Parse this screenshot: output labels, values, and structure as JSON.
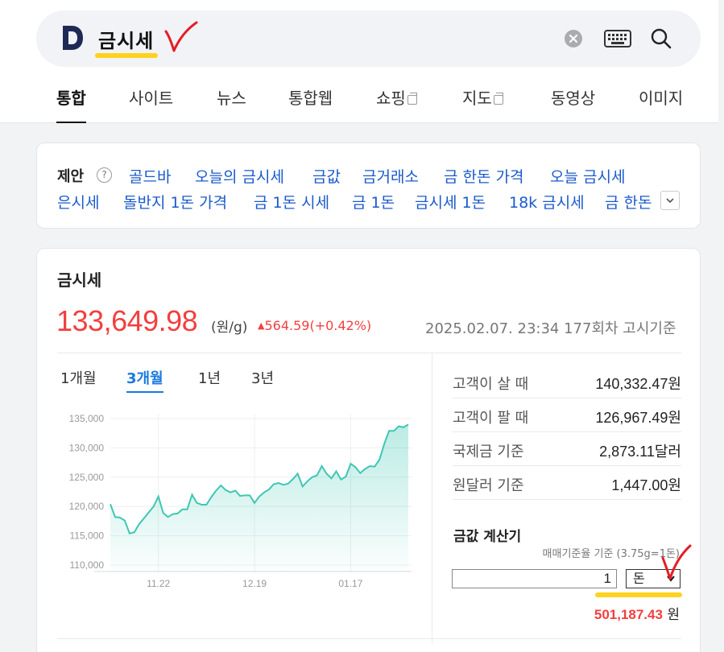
{
  "search": {
    "query": "금시세",
    "logo_letter": "D"
  },
  "tabs": [
    {
      "label": "통합",
      "active": true
    },
    {
      "label": "사이트"
    },
    {
      "label": "뉴스"
    },
    {
      "label": "통합웹"
    },
    {
      "label": "쇼핑",
      "external": true
    },
    {
      "label": "지도",
      "external": true
    },
    {
      "label": "동영상"
    },
    {
      "label": "이미지"
    }
  ],
  "suggestions": {
    "title": "제안",
    "help": "?",
    "row1": [
      "골드바",
      "오늘의 금시세",
      "금값",
      "금거래소",
      "금 한돈 가격",
      "오늘 금시세"
    ],
    "row2": [
      "은시세",
      "돌반지 1돈 가격",
      "금 1돈 시세",
      "금 1돈",
      "금시세 1돈",
      "18k 금시세",
      "금 한돈"
    ]
  },
  "gold": {
    "title": "금시세",
    "price": "133,649.98",
    "unit": "(원/g)",
    "change": "564.59(+0.42%)",
    "change_color": "#f23f3f",
    "timestamp": "2025.02.07. 23:34 177회차 고시기준",
    "period_tabs": [
      {
        "label": "1개월"
      },
      {
        "label": "3개월",
        "active": true
      },
      {
        "label": "1년"
      },
      {
        "label": "3년"
      }
    ],
    "info": [
      {
        "label": "고객이 살 때",
        "value": "140,332.47원"
      },
      {
        "label": "고객이 팔 때",
        "value": "126,967.49원"
      },
      {
        "label": "국제금 기준",
        "value": "2,873.11달러"
      },
      {
        "label": "원달러 기준",
        "value": "1,447.00원"
      }
    ],
    "calculator": {
      "title": "금값 계산기",
      "note": "매매기준율 기준 (3.75g=1돈)",
      "input_value": "1",
      "unit_selected": "돈",
      "result_value": "501,187.43",
      "result_unit": "원"
    }
  },
  "chart_data": {
    "type": "area",
    "color": "#3ec7b3",
    "ylim": [
      110000,
      135000
    ],
    "yticks": [
      "135,000",
      "130,000",
      "125,000",
      "120,000",
      "115,000",
      "110,000"
    ],
    "ytick_values": [
      135000,
      130000,
      125000,
      120000,
      115000,
      110000
    ],
    "xticks": [
      "11.22",
      "12.19",
      "01.17"
    ],
    "xtick_index": [
      10,
      30,
      50
    ],
    "values": [
      120400,
      118200,
      118100,
      117600,
      115400,
      115600,
      117000,
      118000,
      119000,
      120000,
      121700,
      118900,
      118200,
      118700,
      118800,
      119500,
      119500,
      122000,
      120600,
      120300,
      120300,
      121600,
      122700,
      123600,
      122800,
      122400,
      122700,
      121800,
      121900,
      121900,
      120600,
      121700,
      122400,
      122900,
      123800,
      124000,
      123700,
      123900,
      124700,
      125600,
      123400,
      124300,
      125000,
      125300,
      126900,
      125600,
      124800,
      126000,
      124600,
      125100,
      127300,
      126700,
      125700,
      126400,
      126900,
      126800,
      128000,
      130700,
      132900,
      132900,
      133700,
      133500,
      134000
    ]
  }
}
